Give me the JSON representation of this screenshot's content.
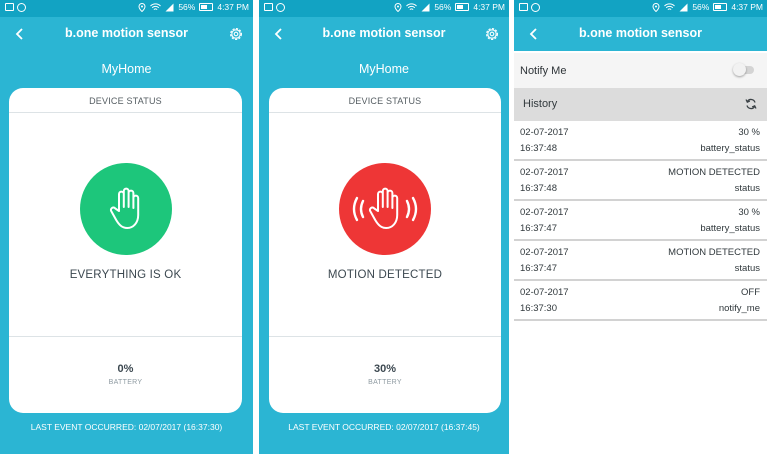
{
  "colors": {
    "accent": "#2bb5d3",
    "status_bar": "#12a3c3",
    "ok_green": "#1dc67b",
    "alert_red": "#ee3636"
  },
  "statusbar": {
    "battery_percent": "56%",
    "time": "4:37 PM"
  },
  "screens": [
    {
      "title": "b.one motion sensor",
      "home": "MyHome",
      "card_header": "DEVICE STATUS",
      "status_text": "EVERYTHING IS OK",
      "status_icon": "hand-icon",
      "battery_value": "0%",
      "battery_label": "BATTERY",
      "last_event": "LAST EVENT OCCURRED: 02/07/2017 (16:37:30)"
    },
    {
      "title": "b.one motion sensor",
      "home": "MyHome",
      "card_header": "DEVICE STATUS",
      "status_text": "MOTION DETECTED",
      "status_icon": "waving-hand-icon",
      "battery_value": "30%",
      "battery_label": "BATTERY",
      "last_event": "LAST EVENT OCCURRED: 02/07/2017 (16:37:45)"
    }
  ],
  "history_screen": {
    "title": "b.one motion sensor",
    "notify_label": "Notify Me",
    "notify_on": false,
    "history_label": "History",
    "items": [
      {
        "date": "02-07-2017",
        "time": "16:37:48",
        "value": "30 %",
        "type": "battery_status"
      },
      {
        "date": "02-07-2017",
        "time": "16:37:48",
        "value": "MOTION DETECTED",
        "type": "status"
      },
      {
        "date": "02-07-2017",
        "time": "16:37:47",
        "value": "30 %",
        "type": "battery_status"
      },
      {
        "date": "02-07-2017",
        "time": "16:37:47",
        "value": "MOTION DETECTED",
        "type": "status"
      },
      {
        "date": "02-07-2017",
        "time": "16:37:30",
        "value": "OFF",
        "type": "notify_me"
      }
    ]
  }
}
